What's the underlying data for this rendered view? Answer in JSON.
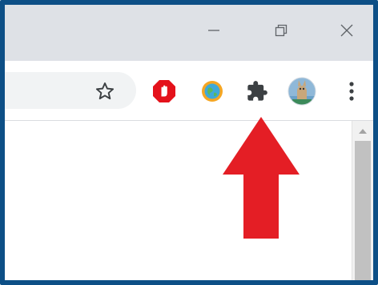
{
  "window_controls": {
    "minimize": "minimize-icon",
    "restore": "restore-icon",
    "close": "close-icon"
  },
  "toolbar": {
    "icons": [
      "star-icon",
      "adblock-icon",
      "globe-extension-icon",
      "extensions-puzzle-icon",
      "profile-avatar",
      "more-menu-icon"
    ]
  },
  "annotation": {
    "arrow_color": "#e41e25",
    "points_to": "extensions-puzzle-icon"
  },
  "colors": {
    "frame_border": "#0d4f86",
    "titlebar": "#dee1e6",
    "omnibox": "#f1f3f4",
    "icon_gray": "#5f6368"
  }
}
